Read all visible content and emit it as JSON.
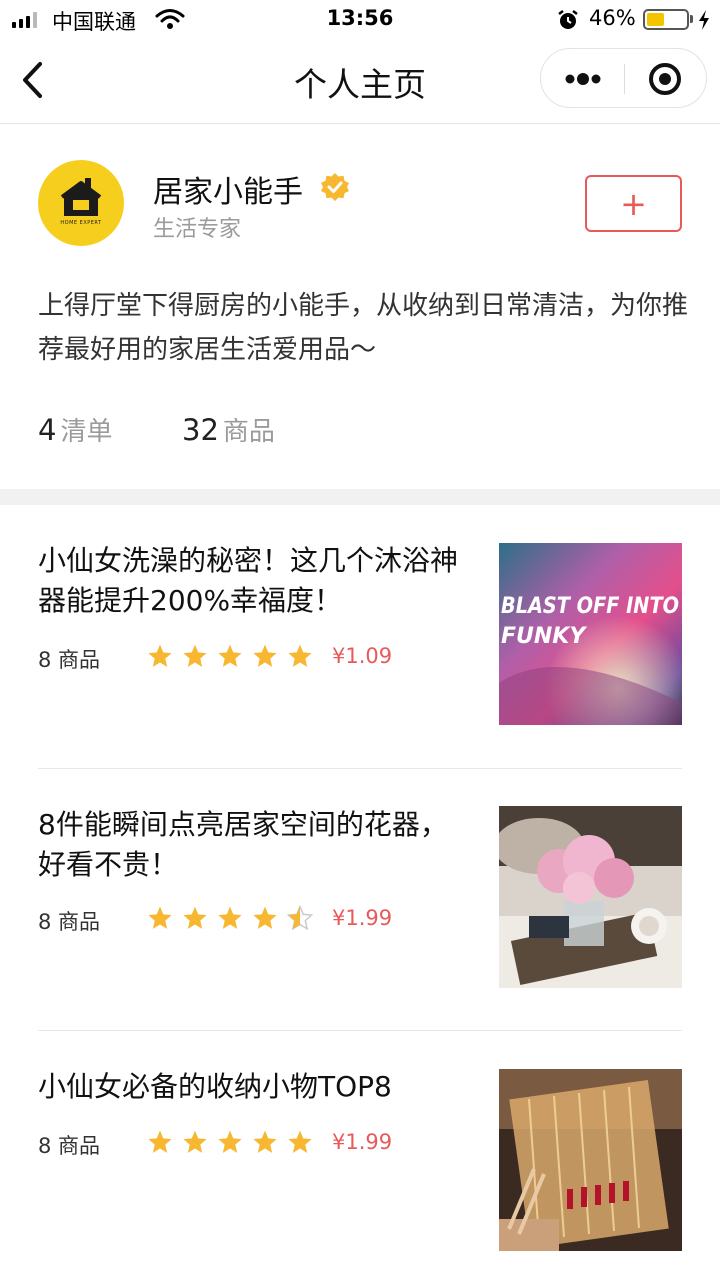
{
  "status_bar": {
    "carrier": "中国联通",
    "time": "13:56",
    "battery_percent": "46%",
    "battery_level": 0.46
  },
  "nav": {
    "title": "个人主页"
  },
  "profile": {
    "name": "居家小能手",
    "subtitle": "生活专家",
    "avatar_text": "HOME EXPERT",
    "follow_label": "+",
    "bio": "上得厅堂下得厨房的小能手，从收纳到日常清洁，为你推荐最好用的家居生活爱用品～",
    "stats": [
      {
        "value": "4",
        "label": "清单"
      },
      {
        "value": "32",
        "label": "商品"
      }
    ]
  },
  "lists": [
    {
      "title": "小仙女洗澡的秘密！这几个沐浴神器能提升200%幸福度！",
      "count": "8 商品",
      "rating": 5,
      "price": "¥1.09",
      "thumb_text": "BLAST OFF INTO FUNKY"
    },
    {
      "title": "8件能瞬间点亮居家空间的花器，好看不贵！",
      "count": "8 商品",
      "rating": 4.5,
      "price": "¥1.99"
    },
    {
      "title": "小仙女必备的收纳小物TOP8",
      "count": "8 商品",
      "rating": 5,
      "price": "¥1.99"
    }
  ],
  "colors": {
    "accent": "#e8595a",
    "star": "#f7b731",
    "avatar_bg": "#f6cf1e"
  }
}
